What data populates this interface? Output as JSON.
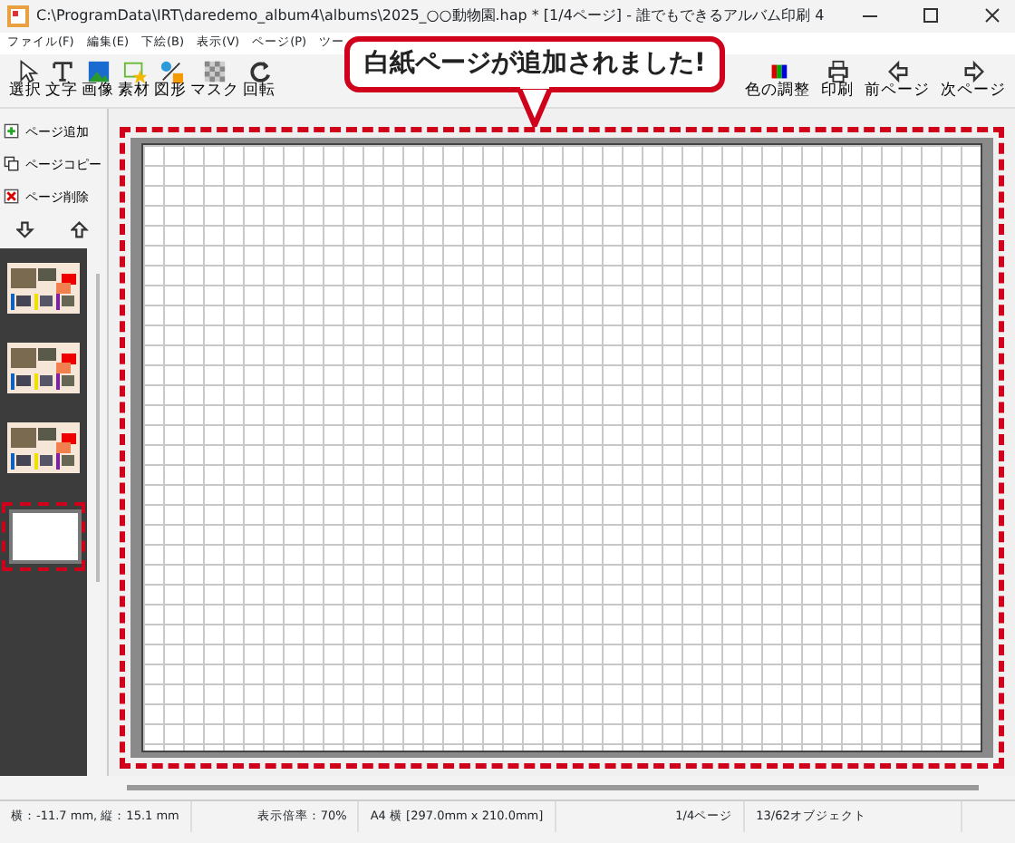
{
  "window": {
    "title": "C:\\ProgramData\\IRT\\daredemo_album4\\albums\\2025_○○動物園.hap *  [1/4ページ] - 誰でもできるアルバム印刷 4"
  },
  "menu": [
    "ファイル(F)",
    "編集(E)",
    "下絵(B)",
    "表示(V)",
    "ページ(P)",
    "ツー"
  ],
  "toolbar_left": [
    "選択",
    "文字",
    "画像",
    "素材",
    "図形",
    "マスク",
    "回転"
  ],
  "toolbar_right": [
    "色の調整",
    "印刷",
    "前ページ",
    "次ページ"
  ],
  "page_actions": [
    "ページ追加",
    "ページコピー",
    "ページ削除"
  ],
  "pages": [
    {
      "kind": "picture",
      "selected": false
    },
    {
      "kind": "picture",
      "selected": false
    },
    {
      "kind": "picture",
      "selected": false
    },
    {
      "kind": "blank",
      "selected": true
    }
  ],
  "callout": "白紙ページが追加されました!",
  "status_bar": [
    "横：-11.7 mm, 縦：15.1 mm",
    "表示倍率：70%",
    "A4 横 [297.0mm x 210.0mm]",
    "1/4ページ",
    "13/62オブジェクト"
  ]
}
